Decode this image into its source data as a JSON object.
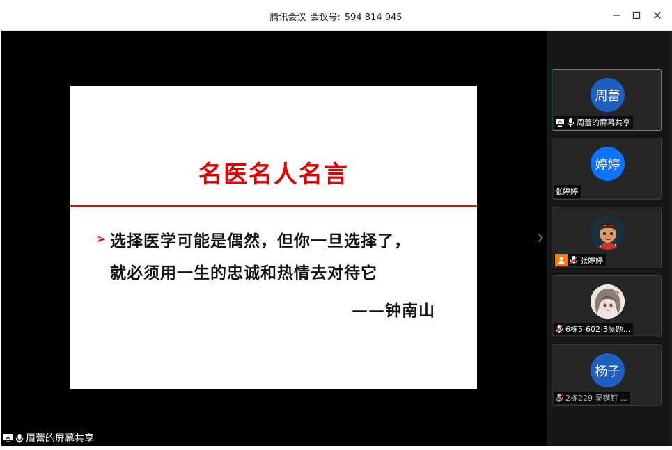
{
  "window": {
    "app_name": "腾讯会议",
    "meeting_id_label": "会议号:",
    "meeting_id": "594 814 945"
  },
  "slide": {
    "title": "名医名人名言",
    "bullet_line1": "选择医学可能是偶然，但你一旦选择了，",
    "bullet_line2": "就必须用一生的忠诚和热情去对待它",
    "author": "——钟南山",
    "accent_color": "#e10000"
  },
  "stage": {
    "share_label": "周蕾的屏幕共享"
  },
  "participants": [
    {
      "avatar_text": "周蕾",
      "label": "周蕾的屏幕共享",
      "icons": [
        "screen-share-icon",
        "mic-on-icon"
      ],
      "active": true
    },
    {
      "avatar_text": "婷婷",
      "label": "张婷婷",
      "icons": []
    },
    {
      "avatar_text": "",
      "label": "张婷婷",
      "icons": [
        "host-icon",
        "mic-muted-icon"
      ]
    },
    {
      "avatar_text": "",
      "label": "6栋5-602-3吴题...",
      "icons": [
        "mic-muted-icon"
      ]
    },
    {
      "avatar_text": "杨子",
      "label": "2栋229 吴锴钉 ...",
      "icons": [
        "mic-muted-icon"
      ]
    }
  ]
}
